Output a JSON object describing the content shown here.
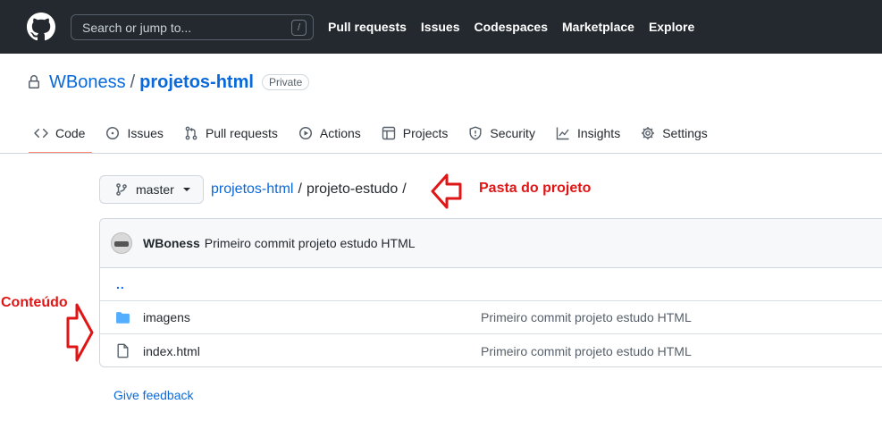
{
  "header": {
    "search_placeholder": "Search or jump to...",
    "slash_key": "/",
    "nav": [
      "Pull requests",
      "Issues",
      "Codespaces",
      "Marketplace",
      "Explore"
    ]
  },
  "repo": {
    "owner": "WBoness",
    "separator": "/",
    "name": "projetos-html",
    "visibility": "Private"
  },
  "tabs": [
    {
      "label": "Code",
      "icon": "code-icon",
      "active": true
    },
    {
      "label": "Issues",
      "icon": "issue-icon"
    },
    {
      "label": "Pull requests",
      "icon": "pull-request-icon"
    },
    {
      "label": "Actions",
      "icon": "play-icon"
    },
    {
      "label": "Projects",
      "icon": "table-icon"
    },
    {
      "label": "Security",
      "icon": "shield-icon"
    },
    {
      "label": "Insights",
      "icon": "graph-icon"
    },
    {
      "label": "Settings",
      "icon": "gear-icon"
    }
  ],
  "branch": {
    "label": "master"
  },
  "breadcrumb": {
    "root": "projetos-html",
    "sep": "/",
    "folder": "projeto-estudo",
    "trailing": "/"
  },
  "commit": {
    "author": "WBoness",
    "message": "Primeiro commit projeto estudo HTML"
  },
  "files": {
    "up": "..",
    "rows": [
      {
        "name": "imagens",
        "type": "folder",
        "commit": "Primeiro commit projeto estudo HTML"
      },
      {
        "name": "index.html",
        "type": "file",
        "commit": "Primeiro commit projeto estudo HTML"
      }
    ]
  },
  "feedback": "Give feedback",
  "annotations": {
    "folder_label": "Pasta do projeto",
    "content_label": "Conteúdo",
    "color": "#e01616"
  }
}
